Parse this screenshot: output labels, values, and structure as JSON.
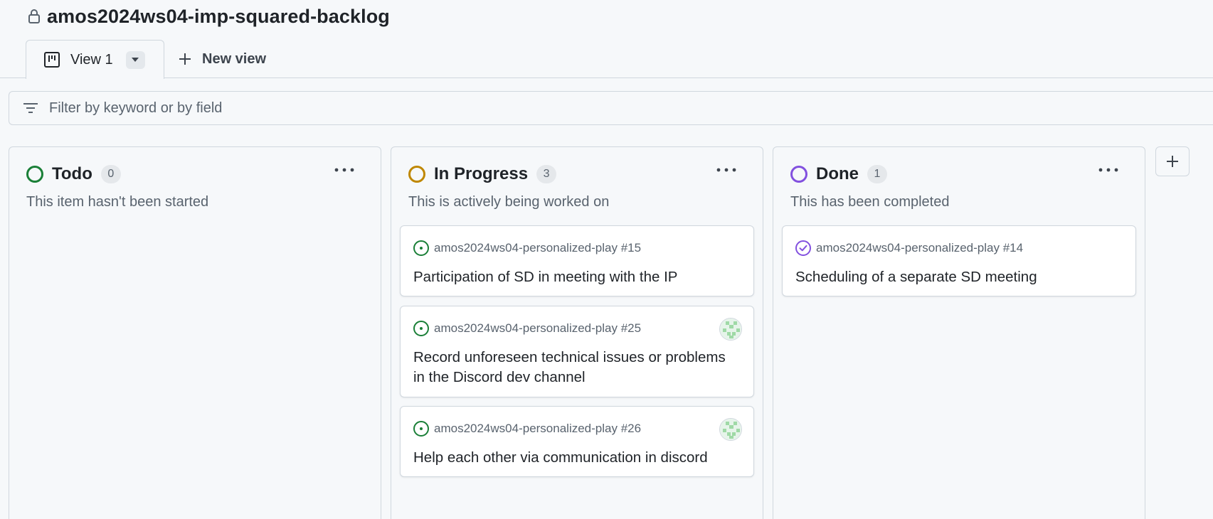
{
  "project": {
    "title": "amos2024ws04-imp-squared-backlog"
  },
  "tabs": {
    "active_label": "View 1",
    "new_view_label": "New view"
  },
  "filter": {
    "placeholder": "Filter by keyword or by field"
  },
  "columns": [
    {
      "title": "Todo",
      "count": "0",
      "description": "This item hasn't been started",
      "color": "#1a7f37",
      "cards": []
    },
    {
      "title": "In Progress",
      "count": "3",
      "description": "This is actively being worked on",
      "color": "#bf8700",
      "cards": [
        {
          "ref": "amos2024ws04-personalized-play #15",
          "title": "Participation of SD in meeting with the IP",
          "status_icon": "issue-open-icon",
          "has_avatar": false
        },
        {
          "ref": "amos2024ws04-personalized-play #25",
          "title": "Record unforeseen technical issues or problems in the Discord dev channel",
          "status_icon": "issue-open-icon",
          "has_avatar": true
        },
        {
          "ref": "amos2024ws04-personalized-play #26",
          "title": "Help each other via communication in discord",
          "status_icon": "issue-open-icon",
          "has_avatar": true
        }
      ]
    },
    {
      "title": "Done",
      "count": "1",
      "description": "This has been completed",
      "color": "#8250df",
      "cards": [
        {
          "ref": "amos2024ws04-personalized-play #14",
          "title": "Scheduling of a separate SD meeting",
          "status_icon": "issue-closed-icon",
          "has_avatar": false
        }
      ]
    }
  ],
  "colors": {
    "open": "#1a7f37",
    "closed": "#8250df",
    "border": "#d0d7de",
    "muted_text": "#59636e"
  }
}
